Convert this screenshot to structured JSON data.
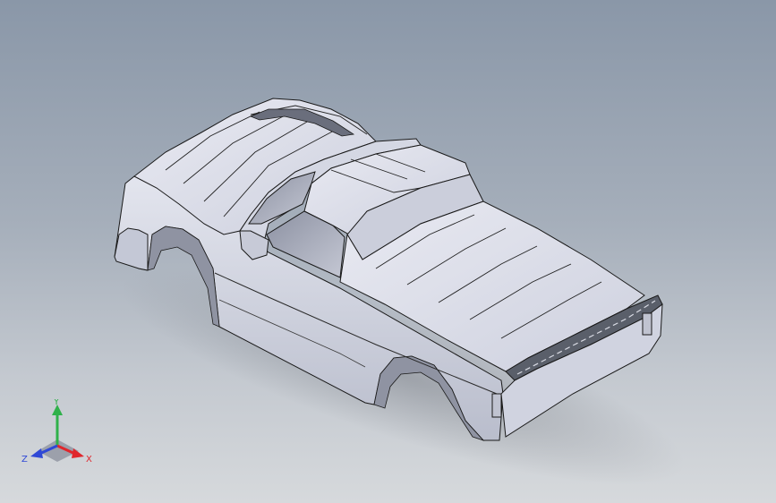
{
  "viewport": {
    "background_top": "#8a97a8",
    "background_bottom": "#d6d9dc",
    "model_subject": "car-body-shell"
  },
  "model": {
    "body_color": "#dadde8",
    "shade_color": "#b3b7c8",
    "edge_color": "#1a1a1a",
    "glass_color": "#9ea3b3",
    "spoiler_color": "#5a5f6a"
  },
  "triad": {
    "x_label": "X",
    "y_label": "Y",
    "z_label": "Z",
    "x_color": "#e0262c",
    "y_color": "#2fb14a",
    "z_color": "#2f48d6"
  }
}
